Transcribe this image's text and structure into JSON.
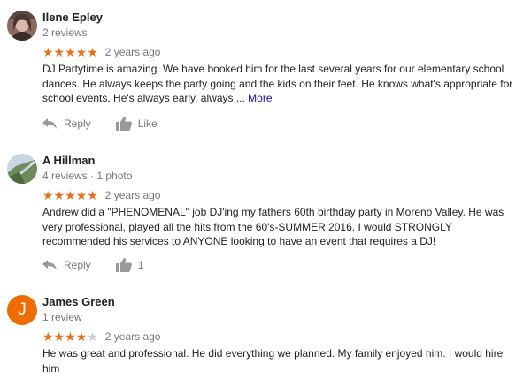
{
  "reviews": [
    {
      "name": "Ilene Epley",
      "meta": "2 reviews",
      "stars": "★★★★★",
      "stars_off": "",
      "rating": 5,
      "age": "2 years ago",
      "text": "DJ Partytime is amazing. We have booked him for the last several years for our elementary school dances. He always keeps the party going and the kids on their feet. He knows what's appropriate for school events. He's always early, always ...",
      "more": "More",
      "reply_label": "Reply",
      "like_label": "Like",
      "avatar_icon": "photo-avatar"
    },
    {
      "name": "A Hillman",
      "meta": "4 reviews · 1 photo",
      "stars": "★★★★★",
      "stars_off": "",
      "rating": 5,
      "age": "2 years ago",
      "text": "Andrew did a \"PHENOMENAL\" job DJ'ing my fathers 60th birthday party in Moreno Valley. He was very professional, played all the hits from the 60's-SUMMER 2016. I would STRONGLY recommended his services to ANYONE looking to have an event that requires a DJ!",
      "reply_label": "Reply",
      "like_count": "1",
      "avatar_icon": "photo-avatar"
    },
    {
      "name": "James Green",
      "meta": "1 review",
      "stars": "★★★★",
      "stars_off": "★",
      "rating": 4,
      "age": "2 years ago",
      "text": "He was great and professional. He did everything we planned. My family enjoyed him. I would hire him",
      "avatar_letter": "J",
      "avatar_color": "#ef6c00"
    }
  ],
  "colors": {
    "star": "#e7711b",
    "link": "#1a0dab",
    "muted": "#777777"
  }
}
